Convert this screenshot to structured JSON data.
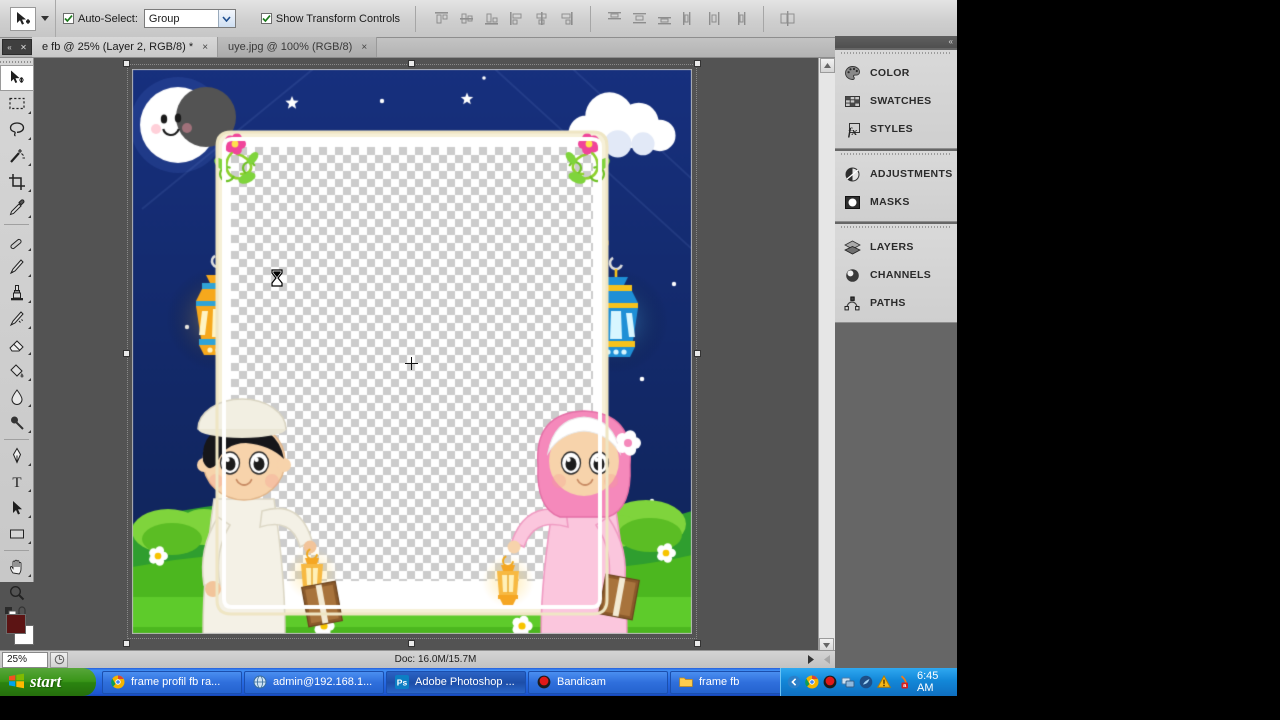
{
  "app": {
    "name": "Adobe Photoshop"
  },
  "options_bar": {
    "tool_preset_name": "move-tool-preset",
    "auto_select": {
      "label": "Auto-Select:",
      "checked": true,
      "value": "Group"
    },
    "show_transform": {
      "label": "Show Transform Controls",
      "checked": true
    },
    "align_icons": [
      "align-top-edges-icon",
      "align-vertical-centers-icon",
      "align-bottom-edges-icon",
      "align-left-edges-icon",
      "align-horizontal-centers-icon",
      "align-right-edges-icon",
      "distribute-top-edges-icon",
      "distribute-vertical-centers-icon",
      "distribute-bottom-edges-icon",
      "distribute-left-edges-icon",
      "distribute-horizontal-centers-icon",
      "distribute-right-edges-icon",
      "auto-align-layers-icon"
    ]
  },
  "tabs": [
    {
      "label": "e fb @ 25% (Layer 2, RGB/8) *",
      "close": "×",
      "active": true
    },
    {
      "label": "uye.jpg @ 100% (RGB/8)",
      "close": "×",
      "active": false
    }
  ],
  "toolbox": {
    "tools": [
      "move-tool",
      "rectangular-marquee-tool",
      "lasso-tool",
      "magic-wand-tool",
      "crop-tool",
      "eyedropper-tool",
      "healing-brush-tool",
      "brush-tool",
      "clone-stamp-tool",
      "history-brush-tool",
      "eraser-tool",
      "paint-bucket-tool",
      "blur-tool",
      "dodge-tool",
      "pen-tool",
      "horizontal-type-tool",
      "path-selection-tool",
      "rectangle-tool",
      "hand-tool",
      "zoom-tool"
    ],
    "selected_tool": "move-tool",
    "foreground_color": "#5c1414",
    "background_color": "#ffffff",
    "quick_mask": "edit-in-quick-mask-mode"
  },
  "document": {
    "zoom": "25%",
    "doc_info": "Doc: 16.0M/15.7M",
    "canvas_description": "ramadan-frame-artwork-with-transparent-center"
  },
  "panels": [
    {
      "group": 1,
      "items": [
        {
          "label": "COLOR",
          "icon": "color-palette-icon"
        },
        {
          "label": "SWATCHES",
          "icon": "swatches-grid-icon"
        },
        {
          "label": "STYLES",
          "icon": "styles-fx-icon"
        }
      ]
    },
    {
      "group": 2,
      "items": [
        {
          "label": "ADJUSTMENTS",
          "icon": "adjustments-halfcircle-icon"
        },
        {
          "label": "MASKS",
          "icon": "masks-circle-icon"
        }
      ]
    },
    {
      "group": 3,
      "items": [
        {
          "label": "LAYERS",
          "icon": "layers-stack-icon"
        },
        {
          "label": "CHANNELS",
          "icon": "channels-sphere-icon"
        },
        {
          "label": "PATHS",
          "icon": "paths-anchor-icon"
        }
      ]
    }
  ],
  "taskbar": {
    "start_label": "start",
    "buttons": [
      {
        "label": "frame profil fb ra...",
        "icon": "chrome-icon",
        "active": false
      },
      {
        "label": "admin@192.168.1...",
        "icon": "remote-desktop-icon",
        "active": false
      },
      {
        "label": "Adobe Photoshop ...",
        "icon": "photoshop-icon",
        "active": true
      },
      {
        "label": "Bandicam",
        "icon": "bandicam-icon",
        "active": false
      },
      {
        "label": "frame fb",
        "icon": "folder-icon",
        "active": false
      }
    ],
    "tray_icons": [
      "show-hidden-icons-chevron",
      "chrome-tray-icon",
      "bandicam-tray-icon",
      "network-tray-icon",
      "idm-tray-icon",
      "warning-triangle-icon",
      "antivirus-tray-icon"
    ],
    "clock": "6:45 AM"
  },
  "colors": {
    "night_sky": "#17307e",
    "grass_green": "#4cb71f",
    "frame_cream": "#f6f0d8",
    "pink": "#f47bb4",
    "taskbar_blue": "#2a70e8"
  }
}
